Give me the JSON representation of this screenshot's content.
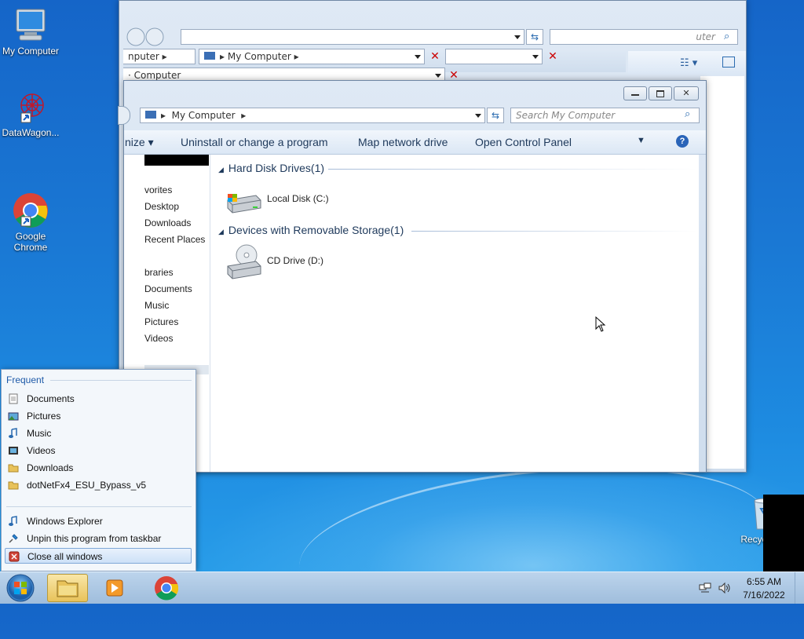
{
  "desktop": {
    "icons": [
      {
        "label": "My Computer",
        "icon": "computer-icon"
      },
      {
        "label": "DataWagon...",
        "icon": "datawagon-icon"
      },
      {
        "label": "Google\nChrome",
        "icon": "chrome-icon"
      },
      {
        "label": "Recycle Bin",
        "icon": "recycle-bin-icon"
      }
    ]
  },
  "back_window_1": {
    "search_placeholder": "uter"
  },
  "back_window_2": {
    "breadcrumb_prefix": "nputer",
    "breadcrumb": "My Computer"
  },
  "back_window_3": {
    "breadcrumb": "Computer"
  },
  "explorer": {
    "breadcrumb": "My Computer",
    "search_placeholder": "Search My Computer",
    "toolbar": {
      "organize": "nize",
      "uninstall": "Uninstall or change a program",
      "map_drive": "Map network drive",
      "control_panel": "Open Control Panel"
    },
    "nav": {
      "favorites": "vorites",
      "desktop": "Desktop",
      "downloads": "Downloads",
      "recent": "Recent Places",
      "libraries": "braries",
      "documents": "Documents",
      "music": "Music",
      "pictures": "Pictures",
      "videos": "Videos"
    },
    "groups": {
      "hdd": "Hard Disk Drives(1)",
      "removable": "Devices with Removable Storage(1)"
    },
    "drives": {
      "local": "Local Disk (C:)",
      "cd": "CD Drive (D:)"
    }
  },
  "jump_list": {
    "header": "Frequent",
    "items": [
      {
        "label": "Documents",
        "icon": "document-icon"
      },
      {
        "label": "Pictures",
        "icon": "pictures-icon"
      },
      {
        "label": "Music",
        "icon": "music-icon"
      },
      {
        "label": "Videos",
        "icon": "videos-icon"
      },
      {
        "label": "Downloads",
        "icon": "folder-icon"
      },
      {
        "label": "dotNetFx4_ESU_Bypass_v5",
        "icon": "folder-icon"
      }
    ],
    "tasks": [
      {
        "label": "Windows Explorer",
        "icon": "explorer-icon"
      },
      {
        "label": "Unpin this program from taskbar",
        "icon": "pin-icon"
      },
      {
        "label": "Close all windows",
        "icon": "close-all-icon"
      }
    ]
  },
  "taskbar": {
    "time": "6:55 AM",
    "date": "7/16/2022"
  },
  "colors": {
    "accent": "#1e395b",
    "link": "#1e5aa8",
    "desktop": "#1a78d4"
  }
}
